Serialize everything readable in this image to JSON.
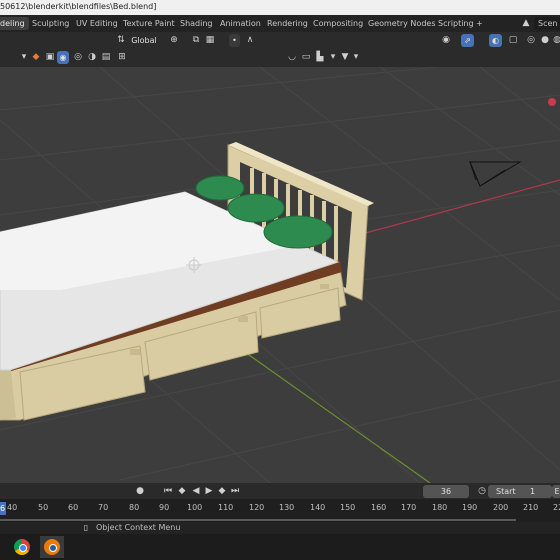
{
  "window": {
    "title": "50612\\blenderkit\\blendfiles\\Bed.blend]"
  },
  "workspaces": [
    "deling",
    "Sculpting",
    "UV Editing",
    "Texture Paint",
    "Shading",
    "Animation",
    "Rendering",
    "Compositing",
    "Geometry Nodes",
    "Scripting",
    "+"
  ],
  "active_workspace": "deling",
  "scene_label": "Scen",
  "header": {
    "orientation": "Global"
  },
  "timeline": {
    "current_frame": "36",
    "start_label": "Start",
    "start_value": "1",
    "end_label": "E",
    "playhead_label": "6",
    "ticks": [
      "40",
      "50",
      "60",
      "70",
      "80",
      "90",
      "100",
      "110",
      "120",
      "130",
      "140",
      "150",
      "160",
      "170",
      "180",
      "190",
      "200",
      "210",
      "22"
    ]
  },
  "status": {
    "context_menu": "Object Context Menu"
  },
  "colors": {
    "accent": "#4772b3",
    "viewport_bg": "#3d3d3d",
    "x_axis": "#cc3a4d",
    "y_axis": "#7fb32d"
  }
}
